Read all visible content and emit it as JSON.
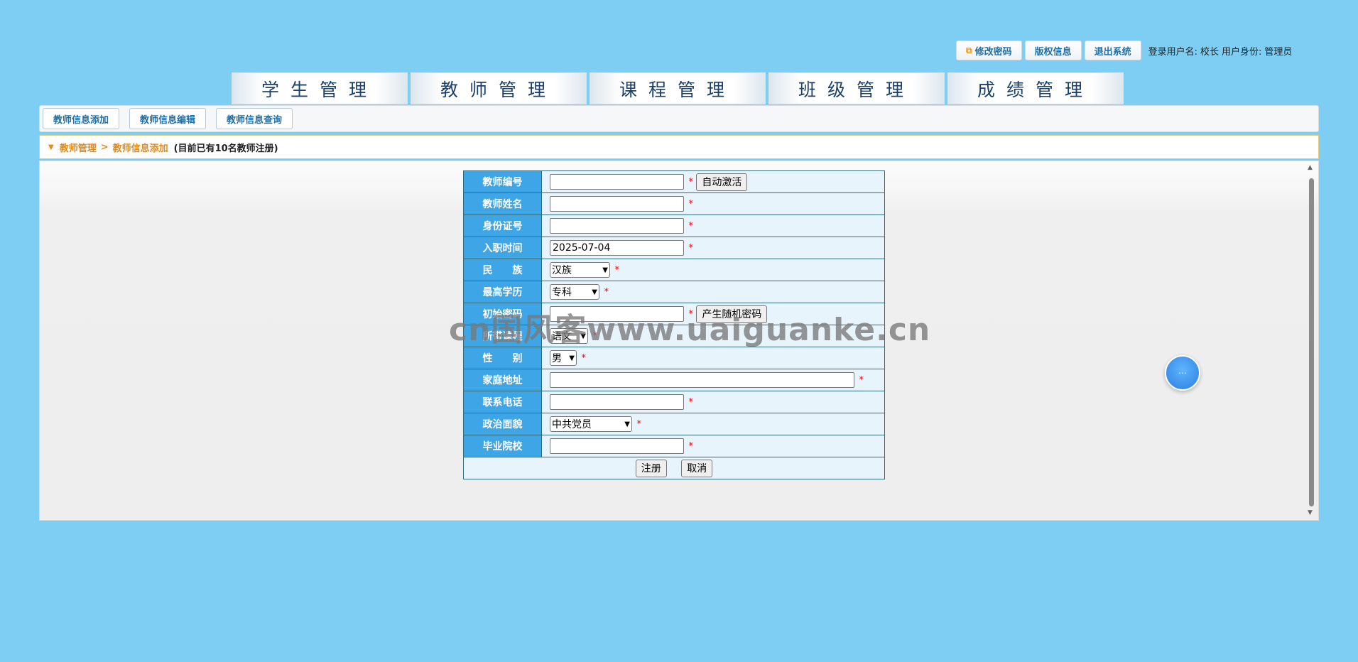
{
  "topbar": {
    "change_password": "修改密码",
    "copyright": "版权信息",
    "logout": "退出系统",
    "user_label": "登录用户名:",
    "user_name": "校长",
    "role_label": "用户身份:",
    "role_name": "管理员"
  },
  "nav": {
    "tabs": [
      {
        "label": "学生管理"
      },
      {
        "label": "教师管理"
      },
      {
        "label": "课程管理"
      },
      {
        "label": "班级管理"
      },
      {
        "label": "成绩管理"
      }
    ]
  },
  "subnav": {
    "items": [
      {
        "label": "教师信息添加"
      },
      {
        "label": "教师信息编辑"
      },
      {
        "label": "教师信息查询"
      }
    ]
  },
  "breadcrumb": {
    "section": "教师管理",
    "separator": ">",
    "page": "教师信息添加",
    "note": "(目前已有10名教师注册)"
  },
  "form": {
    "teacher_id": {
      "label": "教师编号",
      "value": "",
      "button": "自动激活"
    },
    "teacher_name": {
      "label": "教师姓名",
      "value": ""
    },
    "id_card": {
      "label": "身份证号",
      "value": ""
    },
    "hire_date": {
      "label": "入职时间",
      "value": "2025-07-04"
    },
    "ethnicity": {
      "label": "民　　族",
      "selected": "汉族"
    },
    "education": {
      "label": "最高学历",
      "selected": "专科"
    },
    "password": {
      "label": "初始密码",
      "value": "",
      "button": "产生随机密码"
    },
    "course": {
      "label": "所带课程",
      "selected": "语文"
    },
    "gender": {
      "label": "性　　别",
      "selected": "男"
    },
    "address": {
      "label": "家庭地址",
      "value": ""
    },
    "phone": {
      "label": "联系电话",
      "value": ""
    },
    "political": {
      "label": "政治面貌",
      "selected": "中共党员"
    },
    "school": {
      "label": "毕业院校",
      "value": ""
    },
    "required_mark": "*",
    "submit": "注册",
    "cancel": "取消"
  },
  "watermark": "cn国风客www.uaiguanke.cn",
  "colors": {
    "page_bg": "#7ecdf2",
    "label_bg": "#3ea6e6",
    "accent_orange": "#e48a17",
    "link_blue": "#1d6fa8"
  }
}
